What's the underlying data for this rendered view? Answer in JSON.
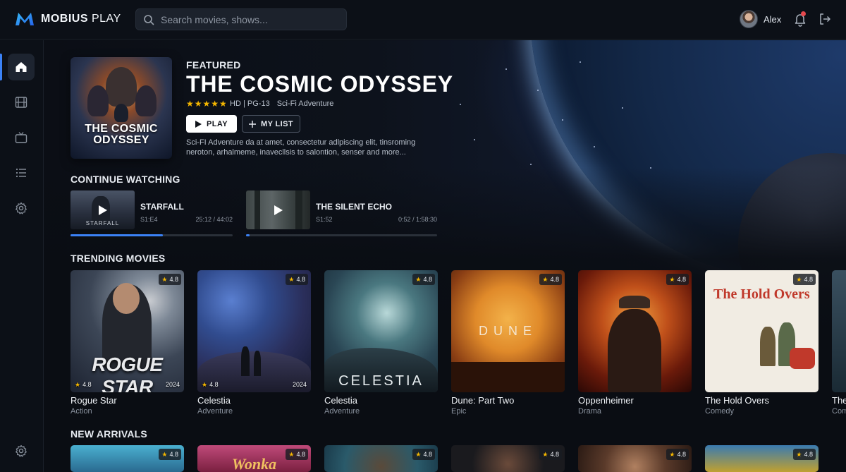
{
  "app": {
    "logo_text_bold": "MOBIUS",
    "logo_text_light": "PLAY",
    "search_placeholder": "Search movies, shows...",
    "user_name": "Alex",
    "colors": {
      "accent": "#3b82f6",
      "star": "#f5b700",
      "notification": "#e5484d",
      "background": "#0a0d13"
    }
  },
  "sidebar": {
    "items": [
      {
        "icon": "home-icon",
        "active": true
      },
      {
        "icon": "film-icon",
        "active": false
      },
      {
        "icon": "tv-icon",
        "active": false
      },
      {
        "icon": "list-icon",
        "active": false
      },
      {
        "icon": "settings-icon",
        "active": false
      },
      {
        "icon": "settings-icon",
        "active": false
      }
    ]
  },
  "featured": {
    "label": "FEATURED",
    "title": "THE COSMIC ODYSSEY",
    "poster_title_line1": "THE COSMIC",
    "poster_title_line2": "ODYSSEY",
    "rating_stars": 4.5,
    "quality": "HD | PG-13",
    "genre": "Sci-Fi Adventure",
    "play_label": "PLAY",
    "list_label": "MY LIST",
    "description": "Sci-FI Adventure da at amet, consectetur adlpiscing elit, tinsroming neroton, arhalmeme, inavecllsis to salontion, senser and more..."
  },
  "continue_watching": {
    "title": "CONTINUE WATCHING",
    "items": [
      {
        "title": "STARFALL",
        "episode": "S1:E4",
        "time": "25:12 / 44:02",
        "thumb_label": "STARFALL",
        "progress": 0.57
      },
      {
        "title": "THE SILENT ECHO",
        "episode": "S1:52",
        "time": "0:52 / 1:58:30",
        "thumb_label": "",
        "progress": 0.02
      }
    ]
  },
  "trending": {
    "title": "TRENDING MOVIES",
    "items": [
      {
        "title": "Rogue Star",
        "genre": "Action",
        "rating": "4.8",
        "bottom_rating": "4.8",
        "year": "2024",
        "poster_text": "ROGUE STAR"
      },
      {
        "title": "Celestia",
        "genre": "Adventure",
        "rating": "4.8",
        "bottom_rating": "4.8",
        "year": "2024",
        "poster_text": ""
      },
      {
        "title": "Celestia",
        "genre": "Adventure",
        "rating": "4.8",
        "bottom_rating": "",
        "year": "",
        "poster_text": "CELESTIA"
      },
      {
        "title": "Dune: Part Two",
        "genre": "Epic",
        "rating": "4.8",
        "bottom_rating": "",
        "year": "",
        "poster_text": "DUNE"
      },
      {
        "title": "Oppenheimer",
        "genre": "Drama",
        "rating": "4.8",
        "bottom_rating": "",
        "year": "",
        "poster_text": ""
      },
      {
        "title": "The Hold Overs",
        "genre": "Comedy",
        "rating": "4.8",
        "bottom_rating": "",
        "year": "",
        "poster_text": "The Hold Overs"
      },
      {
        "title": "The",
        "genre": "Com",
        "rating": "",
        "bottom_rating": "",
        "year": "",
        "poster_text": ""
      }
    ]
  },
  "new_arrivals": {
    "title": "NEW ARRIVALS",
    "items": [
      {
        "rating": "4.8",
        "poster_text": ""
      },
      {
        "rating": "4.8",
        "poster_text": "Wonka"
      },
      {
        "rating": "4.8",
        "poster_text": ""
      },
      {
        "rating": "4.8",
        "poster_text": ""
      },
      {
        "rating": "4.8",
        "poster_text": ""
      },
      {
        "rating": "4.8",
        "poster_text": ""
      }
    ]
  }
}
